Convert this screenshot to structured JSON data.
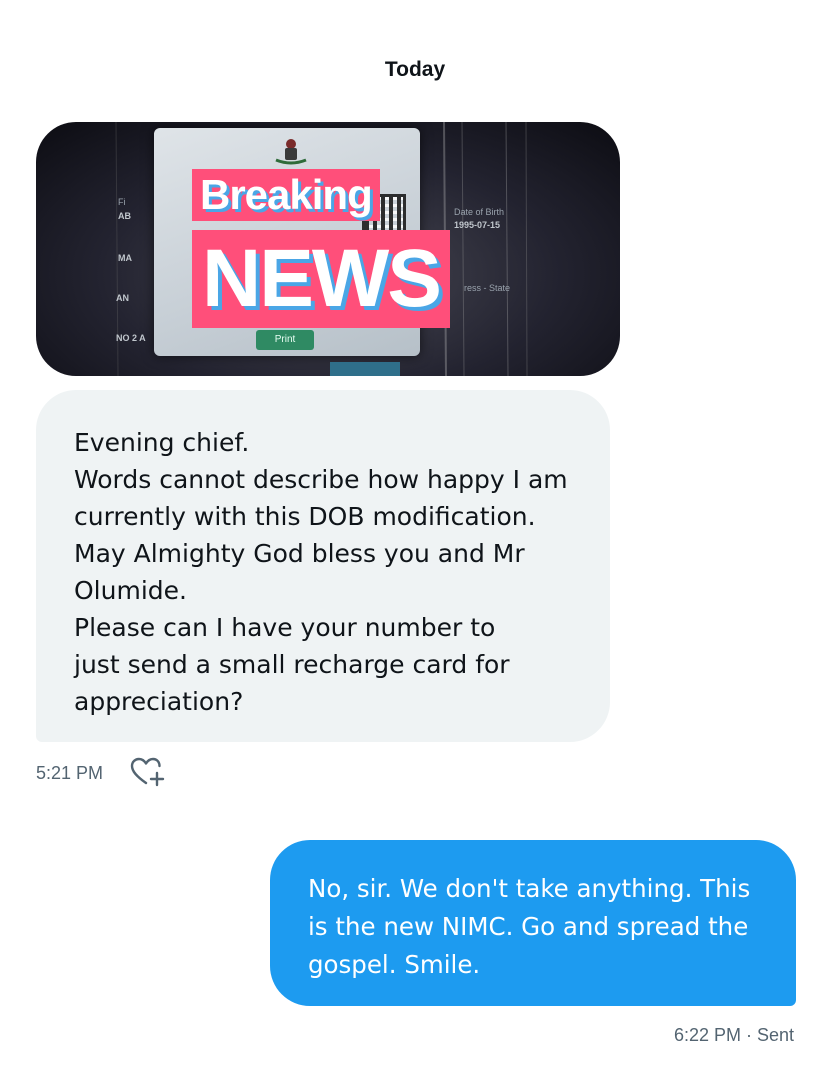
{
  "conversation": {
    "date_separator": "Today",
    "messages": [
      {
        "direction": "incoming",
        "attachment": {
          "type": "image",
          "overlay": {
            "line1": "Breaking",
            "line2": "NEWS"
          },
          "print_button_label": "Print"
        },
        "lines": [
          "Evening chief.",
          "Words cannot describe how happy I am",
          "currently with this DOB modification.",
          "May Almighty God bless you and Mr",
          "Olumide.",
          "Please can I have your number to",
          "just send a small recharge card for",
          "appreciation?"
        ],
        "time": "5:21 PM",
        "reaction_icon": "heart-plus-icon"
      },
      {
        "direction": "outgoing",
        "lines": [
          "No, sir. We don't take anything. This",
          "is the new NIMC. Go and spread the",
          "gospel. Smile."
        ],
        "status": "6:22 PM · Sent"
      }
    ]
  },
  "colors": {
    "outgoing_bubble": "#1d9bf0",
    "incoming_bubble": "#eff3f4",
    "meta_text": "#536471",
    "banner_background": "#ff4f7a",
    "banner_shadow": "#4aa6e6"
  }
}
